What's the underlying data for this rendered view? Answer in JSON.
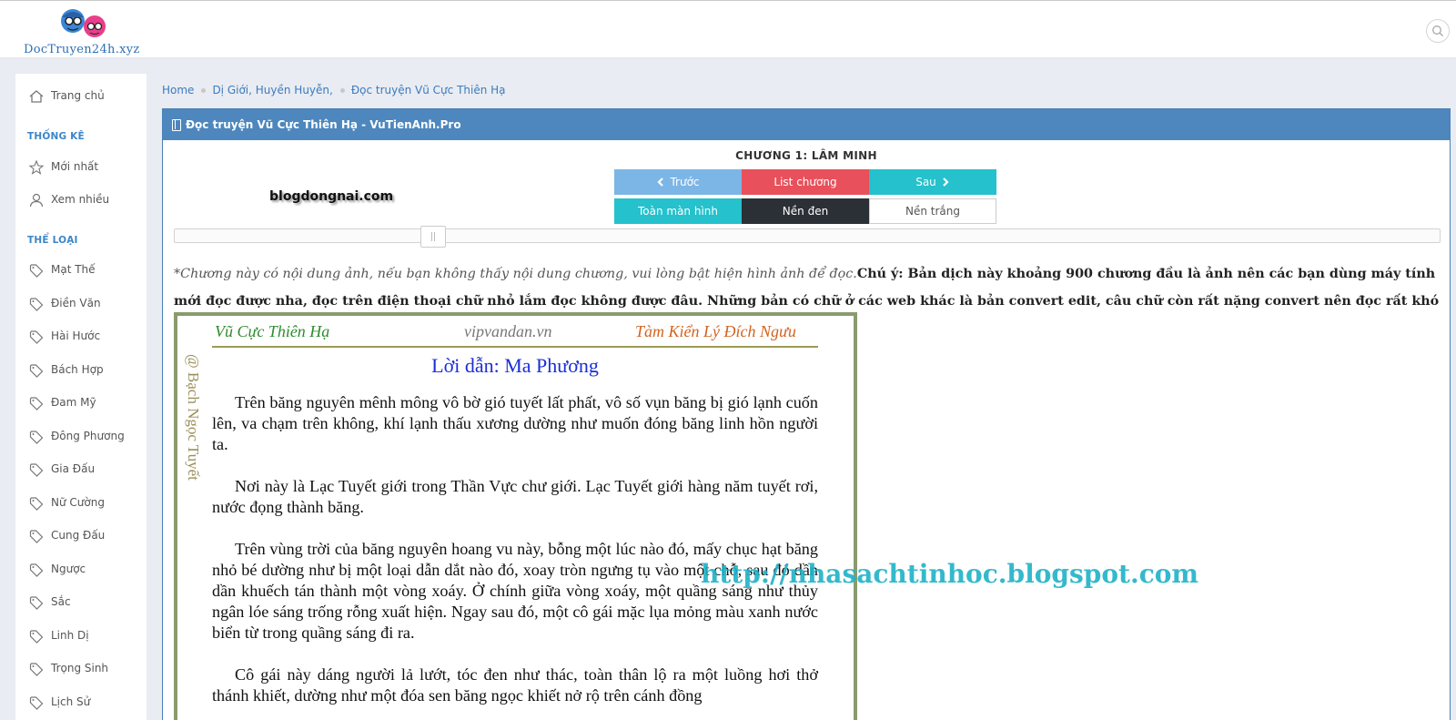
{
  "header": {
    "logo_text": "DocTruyen24h.xyz"
  },
  "sidebar": {
    "home": "Trang chủ",
    "stats_heading": "THỐNG KÊ",
    "stats_items": [
      {
        "label": "Mới nhất",
        "icon": "star-icon"
      },
      {
        "label": "Xem nhiều",
        "icon": "user-icon"
      }
    ],
    "genre_heading": "THỂ LOẠI",
    "genres": [
      "Mạt Thế",
      "Điền Văn",
      "Hài Hước",
      "Bách Hợp",
      "Đam Mỹ",
      "Đông Phương",
      "Gia Đấu",
      "Nữ Cường",
      "Cung Đấu",
      "Ngược",
      "Sắc",
      "Linh Dị",
      "Trọng Sinh",
      "Lịch Sử"
    ]
  },
  "breadcrumb": {
    "items": [
      "Home",
      "Dị Giới, Huyền Huyễn,",
      "Đọc truyện Vũ Cực Thiên Hạ"
    ]
  },
  "panel": {
    "title": "Đọc truyện Vũ Cực Thiên Hạ - VuTienAnh.Pro",
    "chapter_title": "CHƯƠNG 1: LÂM MINH",
    "buttons": {
      "prev": "Trước",
      "list": "List chương",
      "next": "Sau",
      "fullscreen": "Toàn màn hình",
      "dark": "Nền đen",
      "light": "Nền trắng"
    },
    "watermark_left": "blogdongnai.com",
    "notice_italic": "*Chương này có nội dung ảnh, nếu bạn không thấy nội dung chương, vui lòng bật hiện hình ảnh để đọc.",
    "notice_bold": "Chú ý: Bản dịch này khoảng 900 chương đầu là ảnh nên các bạn dùng máy tính mới đọc được nha, đọc trên điện thoại chữ nhỏ lắm đọc không được đâu. Những bản có chữ ở  các web khác là bản convert edit, câu chữ còn rất nặng convert nên đọc rất khó chịu."
  },
  "page_image": {
    "header_left": "Vũ Cực Thiên Hạ",
    "header_mid": "vipvandan.vn",
    "header_right": "Tàm Kiển Lý Đích Ngưu",
    "side_text": "@ Bạch Ngọc Tuyết",
    "title": "Lời dẫn: Ma Phương",
    "paragraphs": [
      "Trên băng nguyên mênh mông vô bờ gió tuyết lất phất, vô số vụn băng bị gió lạnh cuốn lên, va chạm trên không, khí lạnh thấu xương dường như muốn đóng băng linh hồn người ta.",
      "Nơi này là Lạc Tuyết giới trong Thần Vực chư giới. Lạc Tuyết giới hàng năm tuyết rơi, nước đọng thành băng.",
      "Trên vùng trời của băng nguyên hoang vu này, bỗng một lúc nào đó, mấy chục hạt băng nhỏ bé dường như bị một loại dẫn dắt nào đó, xoay tròn ngưng tụ vào một chỗ, sau đó dần dần khuếch tán thành một vòng xoáy. Ở chính giữa vòng xoáy, một quầng sáng như thủy ngân lóe sáng trống rỗng xuất hiện. Ngay sau đó, một cô gái mặc lụa mỏng màu xanh nước biển từ trong quầng sáng đi ra.",
      "Cô gái này dáng người lả lướt, tóc đen như thác, toàn thân lộ ra một luồng hơi thở thánh khiết, dường như một đóa sen băng ngọc khiết nở rộ trên cánh đồng"
    ]
  },
  "watermark_url": "http://nhasachtinhoc.blogspot.com",
  "colors": {
    "panel_header": "#4d87bd",
    "btn_prev": "#7cb6e6",
    "btn_list": "#e8505b",
    "btn_teal": "#25c1cc",
    "btn_dark": "#2b2f36",
    "sidebar_heading": "#3b86c8"
  }
}
